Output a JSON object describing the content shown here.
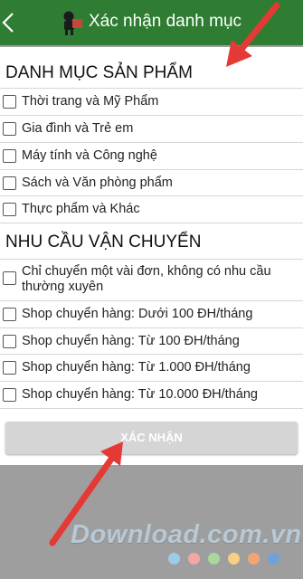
{
  "header": {
    "title": "Xác nhận danh mục",
    "bg_color": "#2e7d32"
  },
  "sections": [
    {
      "title": "DANH MỤC SẢN PHẨM",
      "items": [
        {
          "label": "Thời trang và Mỹ Phẩm",
          "checked": false
        },
        {
          "label": "Gia đình và Trẻ em",
          "checked": false
        },
        {
          "label": "Máy tính và Công nghệ",
          "checked": false
        },
        {
          "label": "Sách và Văn phòng phẩm",
          "checked": false
        },
        {
          "label": "Thực phẩm và Khác",
          "checked": false
        }
      ]
    },
    {
      "title": "NHU CẦU VẬN CHUYỂN",
      "items": [
        {
          "label": "Chỉ chuyển một vài đơn, không có nhu cầu thường xuyên",
          "checked": false
        },
        {
          "label": "Shop chuyển hàng: Dưới 100 ĐH/tháng",
          "checked": false
        },
        {
          "label": "Shop chuyển hàng: Từ 100 ĐH/tháng",
          "checked": false
        },
        {
          "label": "Shop chuyển hàng: Từ 1.000 ĐH/tháng",
          "checked": false
        },
        {
          "label": "Shop chuyển hàng: Từ 10.000 ĐH/tháng",
          "checked": false
        }
      ]
    }
  ],
  "confirm_button": {
    "label": "XÁC NHẬN"
  },
  "watermark": {
    "text": "Download.com.vn",
    "dot_colors": [
      "#9ecbe8",
      "#f4a6a6",
      "#a8d89b",
      "#f7cf85",
      "#f3a571",
      "#6fa3d8"
    ]
  },
  "annotation": {
    "arrow_color": "#e53935"
  }
}
